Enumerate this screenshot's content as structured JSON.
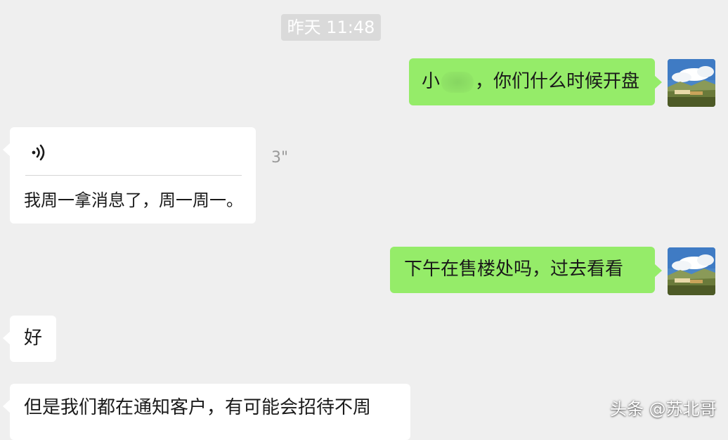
{
  "timestamp": "昨天 11:48",
  "messages": {
    "m1": {
      "prefix": "小",
      "suffix": "，你们什么时候开盘"
    },
    "voice": {
      "transcript": "我周一拿消息了，周一周一。",
      "duration": "3\""
    },
    "m2": {
      "text": "下午在售楼处吗，过去看看"
    },
    "m3": {
      "text": "好"
    },
    "m4": {
      "text": "但是我们都在通知客户，有可能会招待不周"
    }
  },
  "watermark": {
    "text": "头条 @苏北哥"
  },
  "icons": {
    "avatar": "avatar-landscape-icon",
    "voice": "voice-wave-icon"
  },
  "colors": {
    "background": "#efefef",
    "sent_bubble": "#95ec69",
    "received_bubble": "#ffffff",
    "timestamp_bg": "#dadada"
  }
}
